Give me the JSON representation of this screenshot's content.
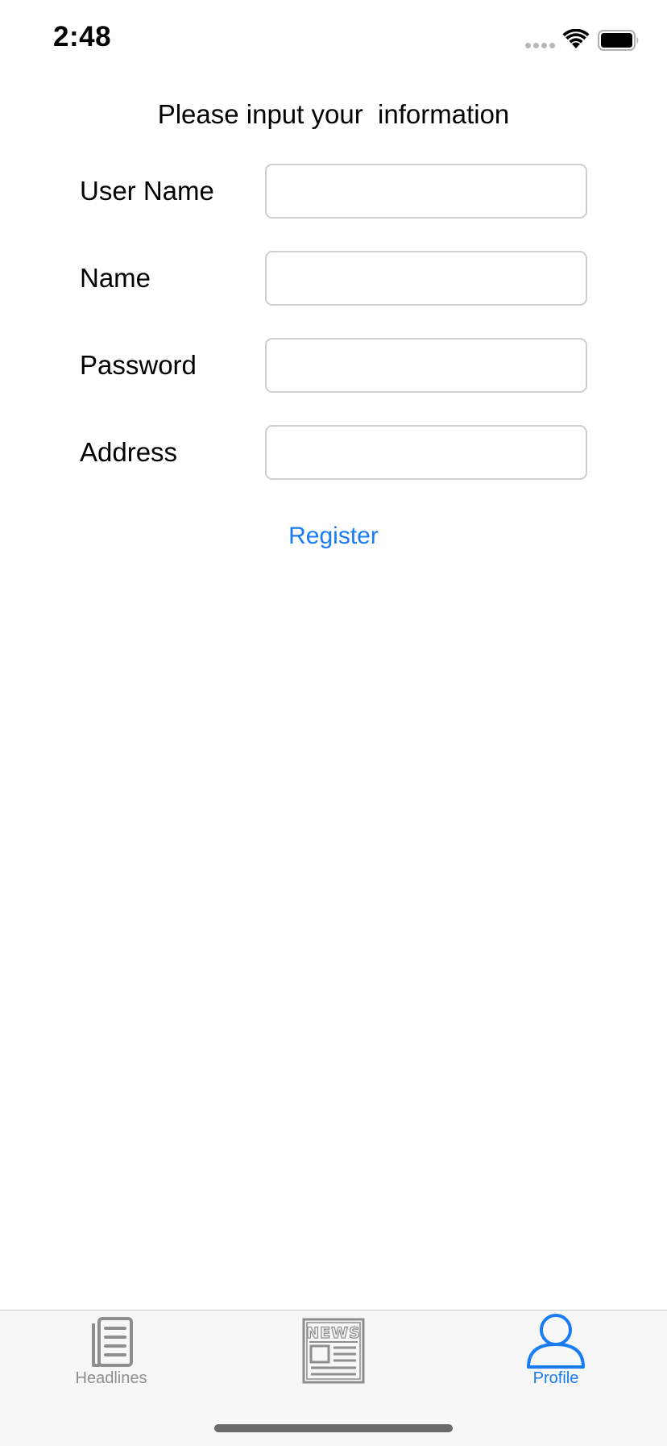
{
  "status_bar": {
    "time": "2:48"
  },
  "form": {
    "title": "Please input your  information",
    "fields": [
      {
        "label": "User Name",
        "value": "",
        "placeholder": ""
      },
      {
        "label": "Name",
        "value": "",
        "placeholder": ""
      },
      {
        "label": "Password",
        "value": "",
        "placeholder": ""
      },
      {
        "label": "Address",
        "value": "",
        "placeholder": ""
      }
    ],
    "register_label": "Register"
  },
  "tab_bar": {
    "tabs": [
      {
        "label": "Headlines",
        "icon": "headlines-icon",
        "active": false
      },
      {
        "label": "",
        "icon": "news-icon",
        "active": false
      },
      {
        "label": "Profile",
        "icon": "profile-icon",
        "active": true
      }
    ]
  },
  "colors": {
    "accent": "#1a7cf5",
    "inactive_tab": "#8e8e8e",
    "input_border": "#cfcfcf",
    "tab_bar_background": "#f7f7f7"
  }
}
